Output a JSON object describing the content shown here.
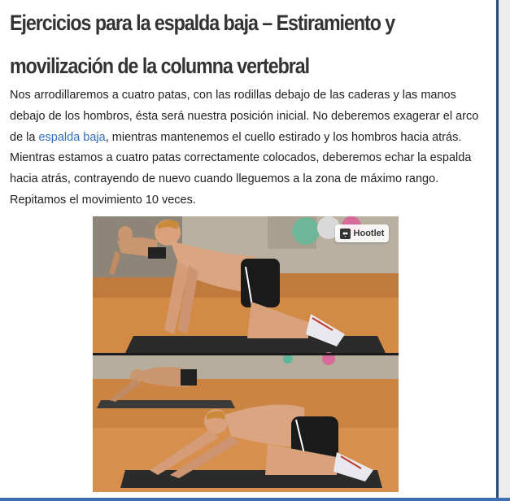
{
  "article": {
    "title": "Ejercicios para la espalda baja – Estiramiento y movilización de la columna vertebral",
    "paragraph1": {
      "before_link": "Nos arrodillaremos a cuatro patas, con las rodillas debajo de las caderas y las manos debajo de los hombros, ésta será nuestra posición inicial. No deberemos exagerar el arco de la ",
      "link": "espalda baja",
      "after_link": ", mientras mantenemos el cuello estirado y los hombros hacia atrás."
    },
    "paragraph2": "Mientras estamos a cuatro patas correctamente colocados, deberemos echar la espalda hacia atrás, contrayendo de nuevo cuando lleguemos a la zona de máximo rango. Repitamos el movimiento 10 veces."
  },
  "image": {
    "overlay_button": "Hootlet",
    "overlay_icon": "owl-icon"
  },
  "colors": {
    "link": "#2f6fbf",
    "title": "#333333",
    "bottom_bar": "#3d6fb3"
  }
}
